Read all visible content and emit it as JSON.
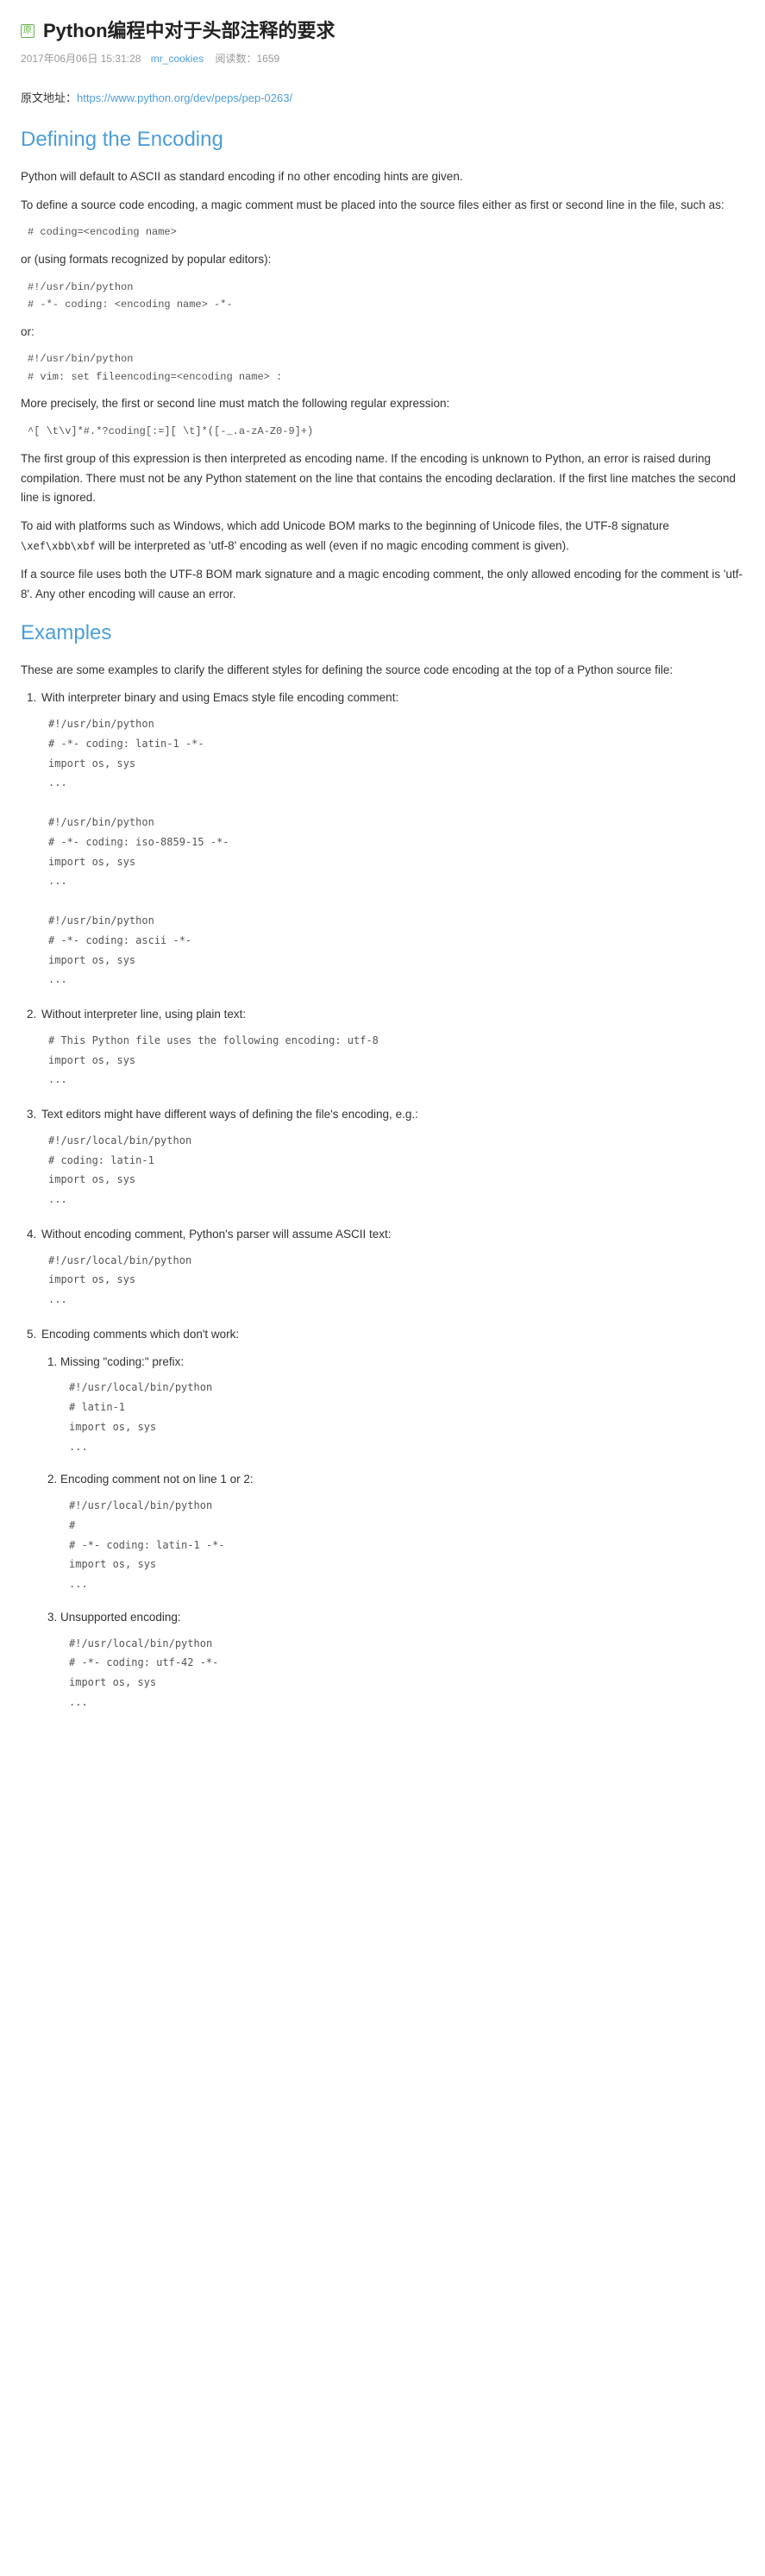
{
  "header": {
    "badge": "原",
    "title": "Python编程中对于头部注释的要求",
    "date": "2017年06月06日 15:31:28",
    "author": "mr_cookies",
    "reads_label": "阅读数：",
    "reads_value": "1659"
  },
  "source": {
    "label": "原文地址：",
    "url": "https://www.python.org/dev/peps/pep-0263/"
  },
  "sec1": {
    "heading": "Defining the Encoding",
    "p1": "Python will default to ASCII as standard encoding if no other encoding hints are given.",
    "p2": "To define a source code encoding, a magic comment must be placed into the source files either as first or second line in the file, such as:",
    "code1": "# coding=<encoding name>",
    "p3": "or (using formats recognized by popular editors):",
    "code2": "#!/usr/bin/python\n# -*- coding: <encoding name> -*-",
    "p4": "or:",
    "code3": "#!/usr/bin/python\n# vim: set fileencoding=<encoding name> :",
    "p5": "More precisely, the first or second line must match the following regular expression:",
    "code4": "^[ \\t\\v]*#.*?coding[:=][ \\t]*([-_.a-zA-Z0-9]+)",
    "p6": "The first group of this expression is then interpreted as encoding name. If the encoding is unknown to Python, an error is raised during compilation. There must not be any Python statement on the line that contains the encoding declaration. If the first line matches the second line is ignored.",
    "p7a": "To aid with platforms such as Windows, which add Unicode BOM marks to the beginning of Unicode files, the UTF-8 signature ",
    "p7code": "\\xef\\xbb\\xbf",
    "p7b": " will be interpreted as 'utf-8' encoding as well (even if no magic encoding comment is given).",
    "p8": "If a source file uses both the UTF-8 BOM mark signature and a magic encoding comment, the only allowed encoding for the comment is 'utf-8'. Any other encoding will cause an error."
  },
  "sec2": {
    "heading": "Examples",
    "intro": "These are some examples to clarify the different styles for defining the source code encoding at the top of a Python source file:",
    "items": [
      {
        "text": "With interpreter binary and using Emacs style file encoding comment:",
        "code": "#!/usr/bin/python\n# -*- coding: latin-1 -*-\nimport os, sys\n...\n\n#!/usr/bin/python\n# -*- coding: iso-8859-15 -*-\nimport os, sys\n...\n\n#!/usr/bin/python\n# -*- coding: ascii -*-\nimport os, sys\n..."
      },
      {
        "text": "Without interpreter line, using plain text:",
        "code": "# This Python file uses the following encoding: utf-8\nimport os, sys\n..."
      },
      {
        "text": "Text editors might have different ways of defining the file's encoding, e.g.:",
        "code": "#!/usr/local/bin/python\n# coding: latin-1\nimport os, sys\n..."
      },
      {
        "text": "Without encoding comment, Python's parser will assume ASCII text:",
        "code": "#!/usr/local/bin/python\nimport os, sys\n..."
      },
      {
        "text": "Encoding comments which don't work:",
        "sub": [
          {
            "text": "Missing \"coding:\" prefix:",
            "code": "#!/usr/local/bin/python\n# latin-1\nimport os, sys\n..."
          },
          {
            "text": "Encoding comment not on line 1 or 2:",
            "code": "#!/usr/local/bin/python\n#\n# -*- coding: latin-1 -*-\nimport os, sys\n..."
          },
          {
            "text": "Unsupported encoding:",
            "code": "#!/usr/local/bin/python\n# -*- coding: utf-42 -*-\nimport os, sys\n..."
          }
        ]
      }
    ]
  }
}
